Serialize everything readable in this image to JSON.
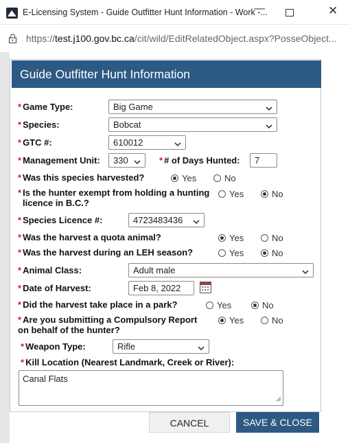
{
  "window": {
    "title": "E-Licensing System - Guide Outfitter Hunt Information - Work -...",
    "url_prefix": "https://",
    "url_host": "test.j100.gov.bc.ca",
    "url_path": "/cit/wild/EditRelatedObject.aspx?PosseObject..."
  },
  "dialog": {
    "title": "Guide Outfitter Hunt Information"
  },
  "form": {
    "required_mark": "*",
    "game_type": {
      "label": "Game Type:",
      "value": "Big Game"
    },
    "species": {
      "label": "Species:",
      "value": "Bobcat"
    },
    "gtc": {
      "label": "GTC #:",
      "value": "610012"
    },
    "management_unit": {
      "label": "Management Unit:",
      "value": "330"
    },
    "days_hunted": {
      "label": "# of Days Hunted:",
      "value": "7"
    },
    "harvested": {
      "label": "Was this species harvested?",
      "yes": "Yes",
      "no": "No",
      "selected": "Yes"
    },
    "exempt": {
      "label_line1": "Is the hunter exempt from holding a hunting",
      "label_line2": "licence in B.C.?",
      "yes": "Yes",
      "no": "No",
      "selected": "No"
    },
    "species_licence": {
      "label": "Species Licence #:",
      "value": "4723483436"
    },
    "quota": {
      "label": "Was the harvest a quota animal?",
      "yes": "Yes",
      "no": "No",
      "selected": "Yes"
    },
    "leh": {
      "label": "Was the harvest during an LEH season?",
      "yes": "Yes",
      "no": "No",
      "selected": "No"
    },
    "animal_class": {
      "label": "Animal Class:",
      "value": "Adult male"
    },
    "date_of_harvest": {
      "label": "Date of Harvest:",
      "value": "Feb 8, 2022"
    },
    "park": {
      "label": "Did the harvest take place in a park?",
      "yes": "Yes",
      "no": "No",
      "selected": "No"
    },
    "compulsory": {
      "label_line1": "Are you submitting a Compulsory Report",
      "label_line2": "on behalf of the hunter?",
      "yes": "Yes",
      "no": "No",
      "selected": "Yes"
    },
    "weapon_type": {
      "label": "Weapon Type:",
      "value": "Rifle"
    },
    "kill_location": {
      "label": "Kill Location (Nearest Landmark, Creek or River):",
      "value": "Canal Flats"
    }
  },
  "buttons": {
    "cancel": "CANCEL",
    "save": "SAVE & CLOSE"
  },
  "colors": {
    "header": "#2d5a84",
    "required": "#cc2222",
    "save_button": "#2d5a84"
  }
}
